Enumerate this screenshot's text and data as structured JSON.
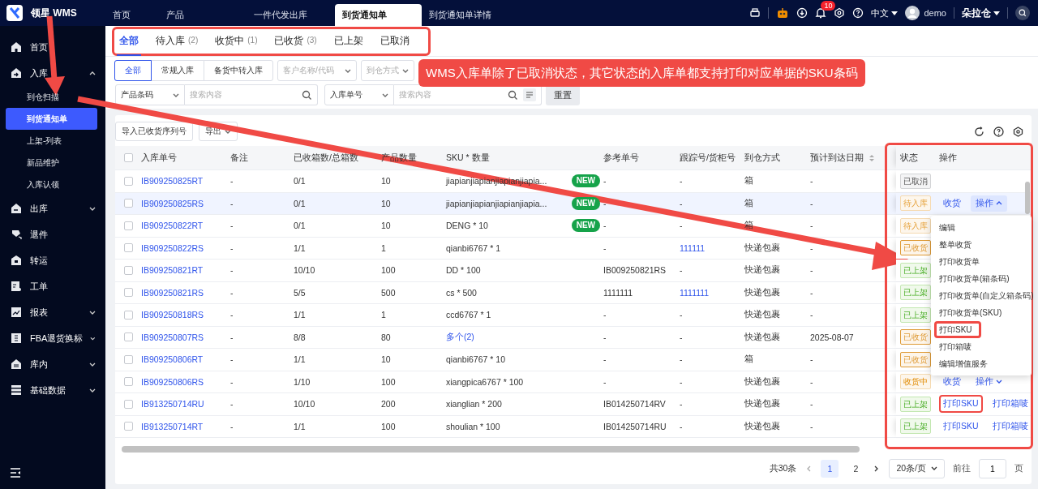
{
  "app": {
    "name": "领星 WMS"
  },
  "nav_tabs": [
    {
      "label": "首页",
      "selected": false
    },
    {
      "label": "产品",
      "selected": false
    },
    {
      "label": "一件代发出库",
      "selected": false
    },
    {
      "label": "到货通知单",
      "selected": true
    },
    {
      "label": "到货通知单详情",
      "selected": false
    }
  ],
  "header": {
    "notification_count": "10",
    "language": "中文",
    "user": "demo",
    "warehouse": "朵拉仓"
  },
  "sidebar": {
    "items": [
      {
        "label": "首页",
        "kind": "link"
      },
      {
        "label": "入库",
        "kind": "group",
        "expanded": true,
        "children": [
          {
            "label": "到仓扫描",
            "selected": false
          },
          {
            "label": "到货通知单",
            "selected": true
          },
          {
            "label": "上架-列表",
            "selected": false
          },
          {
            "label": "新品维护",
            "selected": false
          },
          {
            "label": "入库认领",
            "selected": false
          }
        ]
      },
      {
        "label": "出库",
        "kind": "group",
        "expanded": false
      },
      {
        "label": "退件",
        "kind": "link"
      },
      {
        "label": "转运",
        "kind": "link"
      },
      {
        "label": "工单",
        "kind": "link"
      },
      {
        "label": "报表",
        "kind": "group",
        "expanded": false
      },
      {
        "label": "FBA退货换标",
        "kind": "group",
        "expanded": false
      },
      {
        "label": "库内",
        "kind": "group",
        "expanded": false
      },
      {
        "label": "基础数据",
        "kind": "group",
        "expanded": false
      }
    ]
  },
  "status_tabs": [
    {
      "label": "全部",
      "selected": true
    },
    {
      "label": "待入库",
      "count": "(2)",
      "selected": false
    },
    {
      "label": "收货中",
      "count": "(1)",
      "selected": false
    },
    {
      "label": "已收货",
      "count": "(3)",
      "selected": false
    },
    {
      "label": "已上架",
      "selected": false
    },
    {
      "label": "已取消",
      "selected": false
    }
  ],
  "filters": {
    "type_options": [
      {
        "label": "全部",
        "selected": true
      },
      {
        "label": "常规入库",
        "selected": false
      },
      {
        "label": "备货中转入库",
        "selected": false
      }
    ],
    "customer_select": {
      "placeholder": "客户名称/代码"
    },
    "method_select": {
      "placeholder": "到仓方式"
    },
    "search_1": {
      "field": "产品条码",
      "placeholder": "搜索内容"
    },
    "search_2": {
      "field": "入库单号",
      "placeholder": "搜索内容"
    },
    "reset_button": "重置"
  },
  "toolbar": {
    "buttons": [
      {
        "label": "导入已收货序列号",
        "kind": "plain"
      },
      {
        "label": "导出",
        "kind": "dropdown"
      }
    ]
  },
  "table": {
    "columns": [
      {
        "label": "入库单号"
      },
      {
        "label": "备注"
      },
      {
        "label": "已收箱数/总箱数"
      },
      {
        "label": "产品数量"
      },
      {
        "label": "SKU * 数量"
      },
      {
        "label": "参考单号"
      },
      {
        "label": "跟踪号/货柜号"
      },
      {
        "label": "到仓方式"
      },
      {
        "label": "预计到达日期",
        "sortable": true
      },
      {
        "label": "状态"
      },
      {
        "label": "操作"
      }
    ],
    "header_checked": false,
    "rows": [
      {
        "id": "IB909250825RT",
        "note": "-",
        "boxes": "0/1",
        "qty": "10",
        "sku": "jiapianjiapianjiapianjiapia...",
        "sku_link": false,
        "badge": "NEW",
        "ref": "-",
        "tracking": "-",
        "tracking_link": false,
        "method": "箱",
        "eta": "-",
        "status": {
          "label": "已取消",
          "kind": "cancelled"
        },
        "checked": false,
        "highlighted": false
      },
      {
        "id": "IB909250825RS",
        "note": "-",
        "boxes": "0/1",
        "qty": "10",
        "sku": "jiapianjiapianjiapianjiapia...",
        "sku_link": false,
        "badge": "NEW",
        "ref": "-",
        "tracking": "-",
        "tracking_link": false,
        "method": "箱",
        "eta": "-",
        "status": {
          "label": "待入库",
          "kind": "pending"
        },
        "actions": [
          {
            "label": "收货",
            "kind": "link",
            "annotated": false
          },
          {
            "label": "操作",
            "kind": "menu",
            "expanded": true
          }
        ],
        "checked": false,
        "highlighted": true
      },
      {
        "id": "IB909250822RT",
        "note": "-",
        "boxes": "0/1",
        "qty": "10",
        "sku": "DENG * 10",
        "sku_link": false,
        "badge": "NEW",
        "ref": "-",
        "tracking": "-",
        "tracking_link": false,
        "method": "箱",
        "eta": "-",
        "status": {
          "label": "待入库",
          "kind": "pending"
        },
        "checked": false,
        "highlighted": false
      },
      {
        "id": "IB909250822RS",
        "note": "-",
        "boxes": "1/1",
        "qty": "1",
        "sku": "qianbi6767 * 1",
        "sku_link": false,
        "ref": "-",
        "tracking": "111111",
        "tracking_link": true,
        "method": "快递包裹",
        "eta": "-",
        "status": {
          "label": "已收货",
          "kind": "received"
        },
        "checked": false,
        "highlighted": false
      },
      {
        "id": "IB909250821RT",
        "note": "-",
        "boxes": "10/10",
        "qty": "100",
        "sku": "DD * 100",
        "sku_link": false,
        "ref": "IB009250821RS",
        "tracking": "-",
        "tracking_link": false,
        "method": "快递包裹",
        "eta": "-",
        "status": {
          "label": "已上架",
          "kind": "shelved"
        },
        "checked": false,
        "highlighted": false
      },
      {
        "id": "IB909250821RS",
        "note": "-",
        "boxes": "5/5",
        "qty": "500",
        "sku": "cs * 500",
        "sku_link": false,
        "ref": "1111111",
        "tracking": "1111111",
        "tracking_link": true,
        "method": "快递包裹",
        "eta": "-",
        "status": {
          "label": "已上架",
          "kind": "shelved"
        },
        "checked": false,
        "highlighted": false
      },
      {
        "id": "IB909250818RS",
        "note": "-",
        "boxes": "1/1",
        "qty": "1",
        "sku": "ccd6767 * 1",
        "sku_link": false,
        "ref": "-",
        "tracking": "-",
        "tracking_link": false,
        "method": "快递包裹",
        "eta": "-",
        "status": {
          "label": "已上架",
          "kind": "shelved"
        },
        "checked": false,
        "highlighted": false
      },
      {
        "id": "IB909250807RS",
        "note": "-",
        "boxes": "8/8",
        "qty": "80",
        "sku": "多个(2)",
        "sku_link": true,
        "ref": "-",
        "tracking": "-",
        "tracking_link": false,
        "method": "快递包裹",
        "eta": "2025-08-07",
        "status": {
          "label": "已收货",
          "kind": "received"
        },
        "checked": false,
        "highlighted": false
      },
      {
        "id": "IB909250806RT",
        "note": "-",
        "boxes": "1/1",
        "qty": "10",
        "sku": "qianbi6767 * 10",
        "sku_link": false,
        "ref": "-",
        "tracking": "-",
        "tracking_link": false,
        "method": "箱",
        "eta": "-",
        "status": {
          "label": "已收货",
          "kind": "received"
        },
        "checked": false,
        "highlighted": false
      },
      {
        "id": "IB909250806RS",
        "note": "-",
        "boxes": "1/10",
        "qty": "100",
        "sku": "xiangpica6767 * 100",
        "sku_link": false,
        "ref": "-",
        "tracking": "-",
        "tracking_link": false,
        "method": "快递包裹",
        "eta": "-",
        "status": {
          "label": "收货中",
          "kind": "receiving"
        },
        "actions": [
          {
            "label": "收货",
            "kind": "link",
            "annotated": false
          },
          {
            "label": "操作",
            "kind": "menu",
            "expanded": false
          }
        ],
        "checked": false,
        "highlighted": false
      },
      {
        "id": "IB913250714RU",
        "note": "-",
        "boxes": "10/10",
        "qty": "200",
        "sku": "xianglian * 200",
        "sku_link": false,
        "ref": "IB014250714RV",
        "tracking": "-",
        "tracking_link": false,
        "method": "快递包裹",
        "eta": "-",
        "status": {
          "label": "已上架",
          "kind": "shelved"
        },
        "actions": [
          {
            "label": "打印SKU",
            "kind": "link",
            "annotated": true
          },
          {
            "label": "打印箱唛",
            "kind": "link",
            "annotated": false
          }
        ],
        "checked": false,
        "highlighted": false
      },
      {
        "id": "IB913250714RT",
        "note": "-",
        "boxes": "1/1",
        "qty": "100",
        "sku": "shoulian * 100",
        "sku_link": false,
        "ref": "IB014250714RU",
        "tracking": "-",
        "tracking_link": false,
        "method": "快递包裹",
        "eta": "-",
        "status": {
          "label": "已上架",
          "kind": "shelved"
        },
        "actions": [
          {
            "label": "打印SKU",
            "kind": "link",
            "annotated": false
          },
          {
            "label": "打印箱唛",
            "kind": "link",
            "annotated": false
          }
        ],
        "checked": false,
        "highlighted": false
      }
    ]
  },
  "row_menu": {
    "items": [
      {
        "label": "编辑",
        "annotated": false
      },
      {
        "label": "整单收货",
        "annotated": false
      },
      {
        "label": "打印收货单",
        "annotated": false
      },
      {
        "label": "打印收货单(箱条码)",
        "annotated": false
      },
      {
        "label": "打印收货单(自定义箱条码)",
        "annotated": false
      },
      {
        "label": "打印收货单(SKU)",
        "annotated": false
      },
      {
        "label": "打印SKU",
        "annotated": true
      },
      {
        "label": "打印箱唛",
        "annotated": false
      },
      {
        "label": "编辑增值服务",
        "annotated": false
      }
    ]
  },
  "pagination": {
    "total": "共30条",
    "pages": [
      {
        "label": "1",
        "selected": true
      },
      {
        "label": "2",
        "selected": false
      }
    ],
    "page_size": "20条/页",
    "goto_label": "前往",
    "goto_value": "1",
    "page_unit": "页"
  },
  "annotation": {
    "callout": "WMS入库单除了已取消状态，其它状态的入库单都支持打印对应单据的SKU条码"
  }
}
